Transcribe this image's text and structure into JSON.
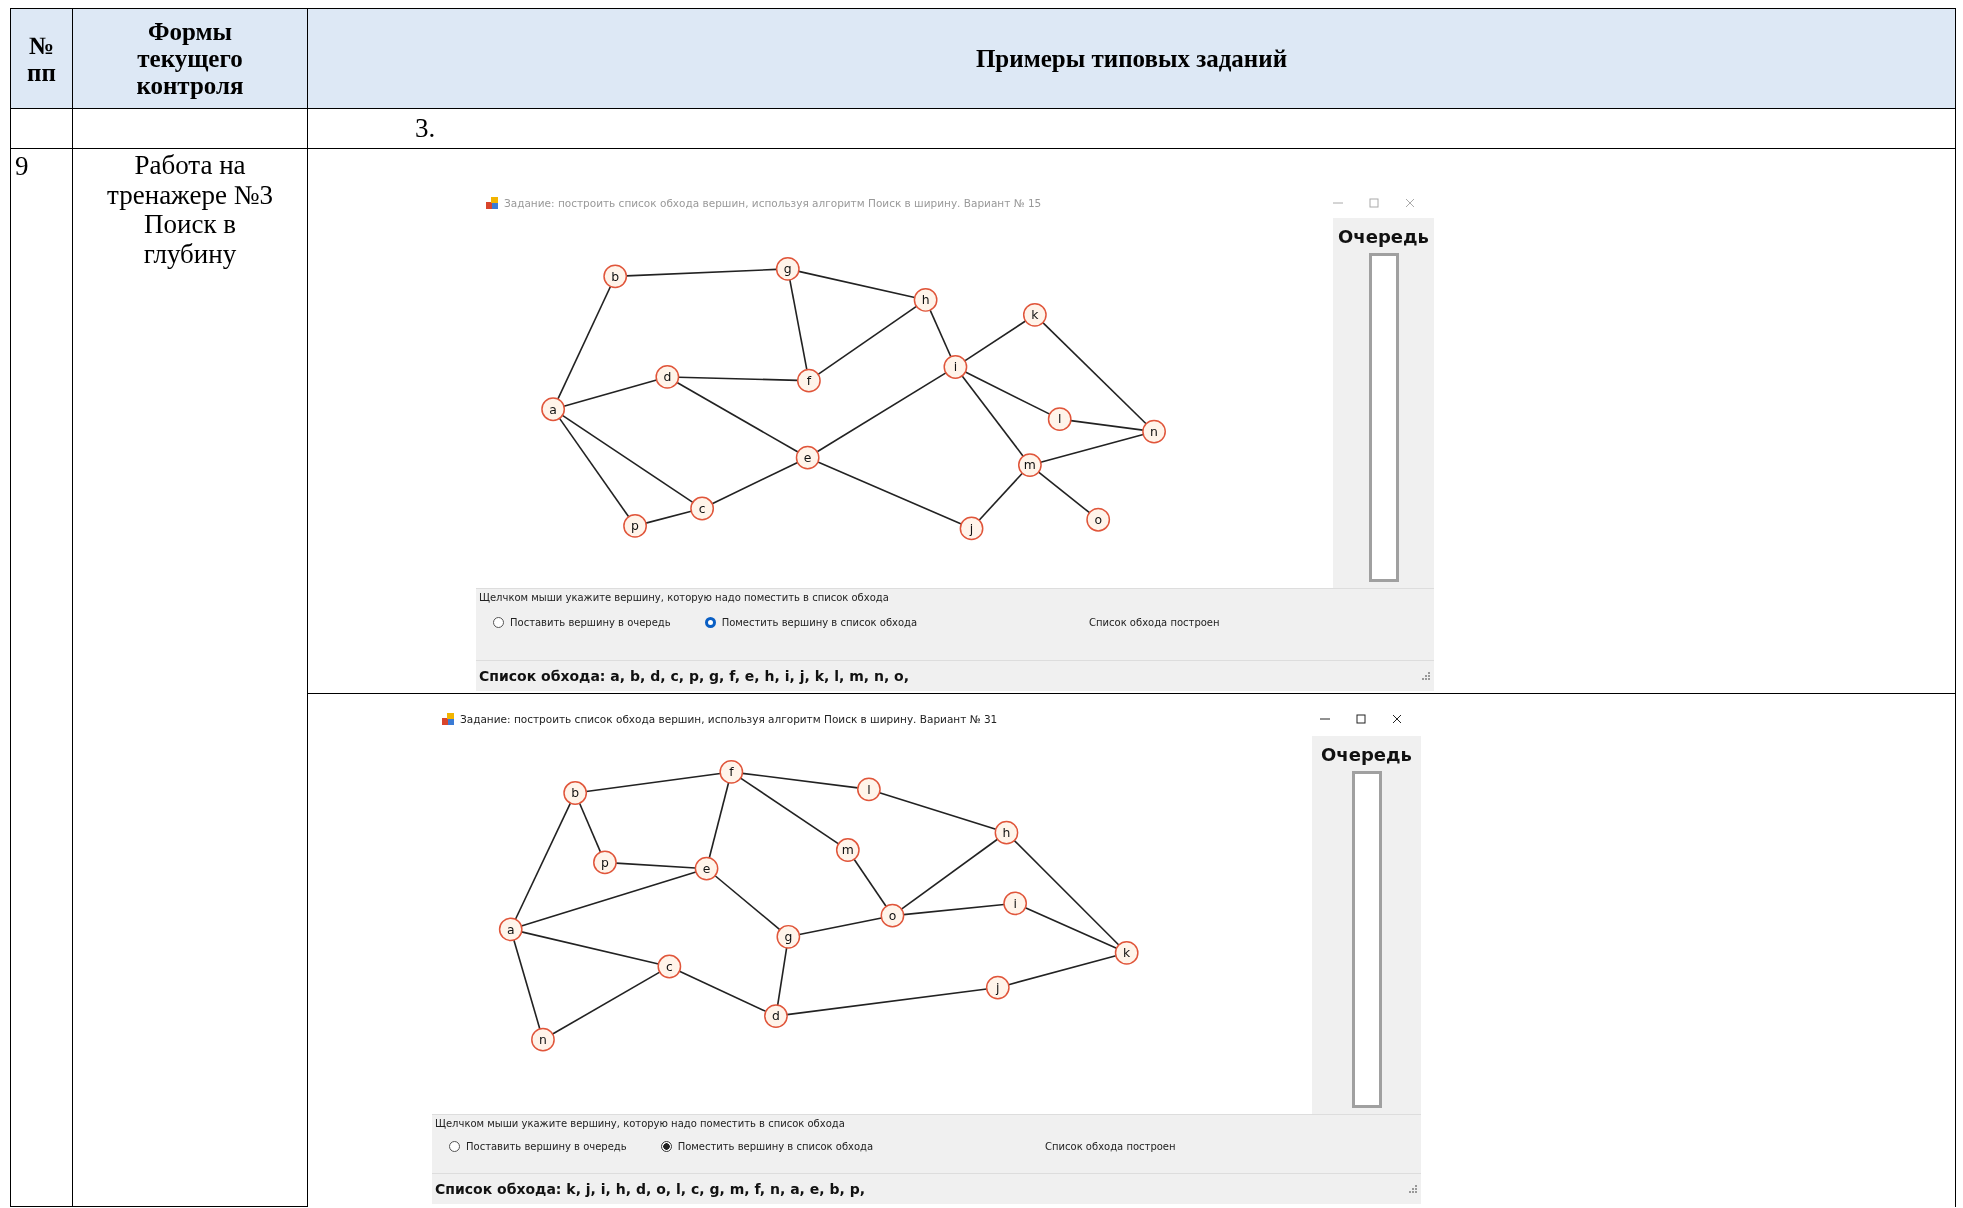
{
  "table": {
    "columns": [
      "№ пп",
      "Формы текущего контроля",
      "Примеры типовых заданий"
    ],
    "rows": [
      {
        "cell_3": "3."
      },
      {
        "number": "9",
        "form": "Работа на тренажере №3 Поиск в глубину",
        "windows": [
          {
            "title": "Задание: построить список обхода вершин, используя алгоритм Поиск в ширину.  Вариант № 15",
            "active": false,
            "queue_label": "Очередь",
            "nodes": [
              "b",
              "g",
              "h",
              "k",
              "d",
              "f",
              "i",
              "a",
              "l",
              "n",
              "e",
              "m",
              "p",
              "c",
              "j",
              "o"
            ],
            "instruction": "Щелчком мыши укажите вершину, которую надо поместить в список обхода",
            "options": [
              {
                "label": "Поставить вершину в очередь",
                "selected": false
              },
              {
                "label": "Поместить вершину в список обхода",
                "selected": true
              }
            ],
            "status": "Список обхода построен",
            "traversal": "Список обхода: a, b, d, c, p, g, f, e, h, i, j, k, l, m, n, o,"
          },
          {
            "title": "Задание: построить список обхода вершин, используя алгоритм Поиск в ширину.  Вариант № 31",
            "active": true,
            "queue_label": "Очередь",
            "nodes": [
              "b",
              "f",
              "l",
              "h",
              "p",
              "e",
              "m",
              "o",
              "i",
              "a",
              "g",
              "c",
              "k",
              "j",
              "d",
              "n"
            ],
            "instruction": "Щелчком мыши укажите вершину, которую надо поместить в список обхода",
            "options": [
              {
                "label": "Поставить вершину в очередь",
                "selected": false
              },
              {
                "label": "Поместить вершину в список обхода",
                "selected": true
              }
            ],
            "status": "Список обхода построен",
            "traversal": "Список обхода: k, j, i, h, d, o, l, c, g, m, f, n, a, e, b, p,"
          }
        ]
      }
    ]
  }
}
